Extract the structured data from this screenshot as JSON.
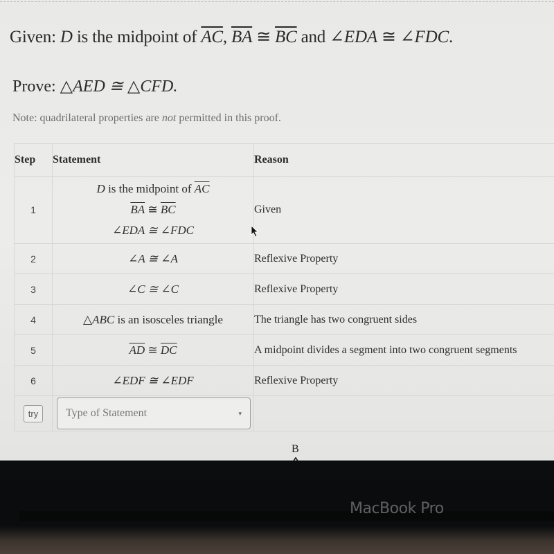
{
  "problem": {
    "given_label": "Given:",
    "given_parts": {
      "d": "D",
      "midpoint_text": " is the midpoint of ",
      "seg_ac": "AC",
      "comma": ", ",
      "seg_ba": "BA",
      "cong1": " ≅ ",
      "seg_bc": "BC",
      "and": " and ",
      "angle_eda": "∠EDA",
      "cong2": " ≅ ",
      "angle_fdc": "∠FDC",
      "period": "."
    },
    "prove_label": "Prove:",
    "prove_statement": "△AED ≅ △CFD.",
    "note_prefix": "Note: quadrilateral properties are ",
    "note_emph": "not",
    "note_suffix": " permitted in this proof."
  },
  "table": {
    "headers": {
      "step": "Step",
      "statement": "Statement",
      "reason": "Reason"
    },
    "rows": [
      {
        "step": "1",
        "statement_lines": {
          "line1_d": "D",
          "line1_text": " is the midpoint of ",
          "line1_seg": "AC",
          "line2_a": "BA",
          "line2_cong": " ≅ ",
          "line2_b": "BC",
          "line3": "∠EDA ≅ ∠FDC"
        },
        "reason": "Given"
      },
      {
        "step": "2",
        "statement": "∠A ≅ ∠A",
        "reason": "Reflexive Property"
      },
      {
        "step": "3",
        "statement": "∠C ≅ ∠C",
        "reason": "Reflexive Property"
      },
      {
        "step": "4",
        "statement_math": "△ABC",
        "statement_text": " is an isosceles triangle",
        "reason": "The triangle has two congruent sides"
      },
      {
        "step": "5",
        "statement_a": "AD",
        "statement_cong": " ≅ ",
        "statement_b": "DC",
        "reason": "A midpoint divides a segment into two congruent segments"
      },
      {
        "step": "6",
        "statement": "∠EDF ≅ ∠EDF",
        "reason": "Reflexive Property"
      }
    ],
    "try_row": {
      "try_label": "try",
      "select_placeholder": "Type of Statement",
      "caret_icon": "▾"
    }
  },
  "diagram": {
    "vertex_label": "B"
  },
  "device": {
    "brand": "MacBook Pro"
  }
}
